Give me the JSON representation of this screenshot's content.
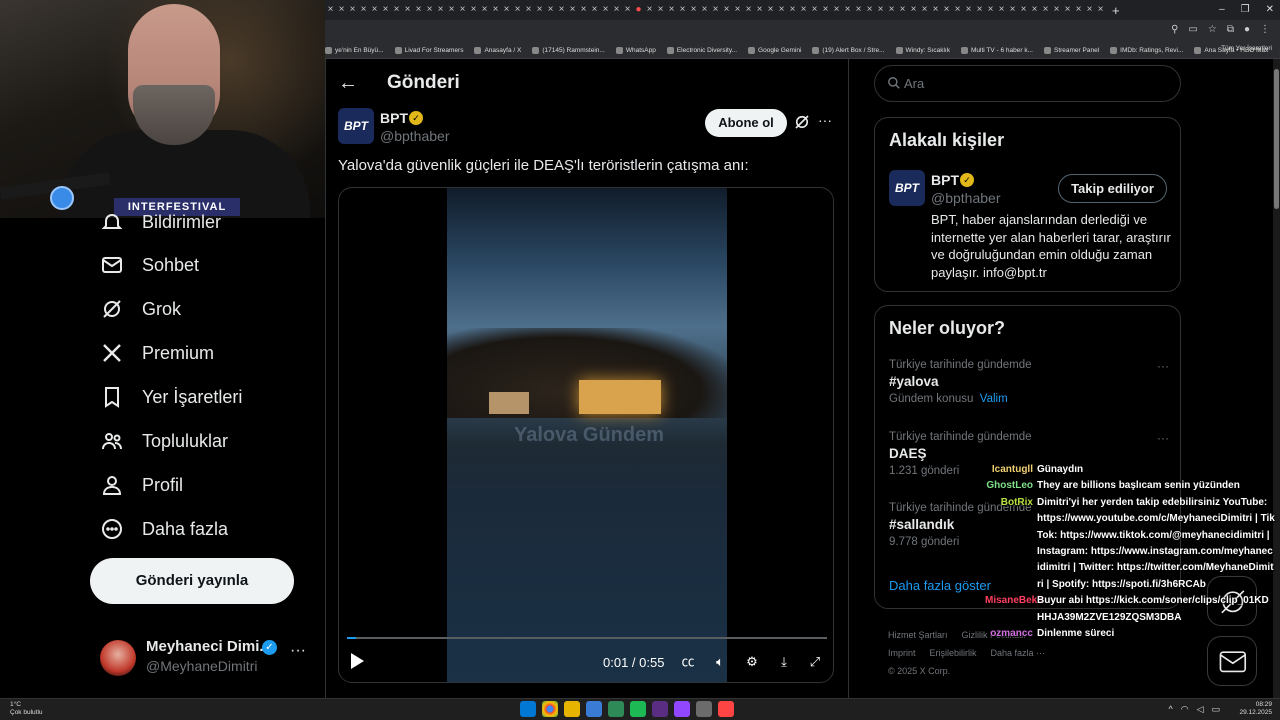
{
  "browser": {
    "bookmarks": [
      "ye'nin En Büyü...",
      "Livad For Streamers",
      "Anasayfa / X",
      "(17145) Rammstein...",
      "WhatsApp",
      "Electronic Diversity...",
      "Google Gemini",
      "(19) Alert Box / Stre...",
      "Windy: Sıcaklık",
      "Multi TV - 6 haber k...",
      "Streamer Panel",
      "IMDb: Ratings, Revi...",
      "Ana Sayfa • HBO Max"
    ],
    "bookmarks_more": "»",
    "all_bookmarks": "Tüm Yer İşaretleri"
  },
  "webcam": {
    "logo_text": "INTERFESTIVAL"
  },
  "nav": {
    "items": [
      {
        "label": "Bildirimler"
      },
      {
        "label": "Sohbet"
      },
      {
        "label": "Grok"
      },
      {
        "label": "Premium"
      },
      {
        "label": "Yer İşaretleri"
      },
      {
        "label": "Topluluklar"
      },
      {
        "label": "Profil"
      },
      {
        "label": "Daha fazla"
      }
    ],
    "post_button": "Gönderi yayınla",
    "profile": {
      "name": "Meyhaneci Dimi...",
      "handle": "@MeyhaneDimitri"
    }
  },
  "main": {
    "title": "Gönderi",
    "author": {
      "avatar_text": "BPT",
      "name": "BPT",
      "handle": "@bpthaber"
    },
    "subscribe_button": "Abone ol",
    "tweet_text": "Yalova'da güvenlik güçleri ile DEAŞ'lı teröristlerin çatışma anı:",
    "video": {
      "watermark": "Yalova Gündem",
      "time": "0:01 / 0:55",
      "progress": 0.018
    }
  },
  "right": {
    "search_placeholder": "Ara",
    "related": {
      "title": "Alakalı kişiler",
      "name": "BPT",
      "handle": "@bpthaber",
      "follow_button": "Takip ediliyor",
      "bio": "BPT, haber ajanslarından derlediği ve internette yer alan haberleri tarar, araştırır ve doğruluğundan emin olduğu zaman paylaşır. info@bpt.tr"
    },
    "trends": {
      "title": "Neler oluyor?",
      "items": [
        {
          "context": "Türkiye tarihinde gündemde",
          "tag": "#yalova",
          "meta": "Gündem konusu",
          "meta_link": "Valim"
        },
        {
          "context": "Türkiye tarihinde gündemde",
          "tag": "DAEŞ",
          "meta": "1.231 gönderi",
          "meta_link": ""
        },
        {
          "context": "Türkiye tarihinde gündemde",
          "tag": "#sallandık",
          "meta": "9.778 gönderi",
          "meta_link": ""
        }
      ],
      "show_more": "Daha fazla göster"
    },
    "footer": {
      "links": [
        "Hizmet Şartları",
        "Gizlilik Politikası",
        "Imprint",
        "Erişilebilirlik",
        "Daha fazla ···"
      ],
      "copyright": "© 2025 X Corp."
    }
  },
  "chat": {
    "messages": [
      {
        "user": "Icantugll",
        "color": "#f0d070",
        "text": "Günaydın"
      },
      {
        "user": "GhostLeo",
        "color": "#7fe08a",
        "text": "They are billions başlıcam senin yüzünden"
      },
      {
        "user": "BotRix",
        "color": "#b8e040",
        "text": "Dimitri'yi her yerden takip edebilirsiniz YouTube: https://www.youtube.com/c/MeyhaneciDimitri | TikTok: https://www.tiktok.com/@meyhanecidimitri | Instagram: https://www.instagram.com/meyhanecidimitri | Twitter: https://twitter.com/MeyhaneDimitri | Spotify: https://spoti.fi/3h6RCAb"
      },
      {
        "user": "MisaneBekir",
        "color": "#ff4060",
        "text": "Buyur abi https://kick.com/soner/clips/clip_01KDHHJA39M2ZVE129ZQSM3DBA"
      },
      {
        "user": "ozmancc",
        "color": "#d070e0",
        "text": "Dinlenme süreci"
      }
    ]
  },
  "taskbar": {
    "weather_temp": "1°C",
    "weather_desc": "Çok bulutlu",
    "time": "08:29",
    "date": "29.12.2025"
  }
}
